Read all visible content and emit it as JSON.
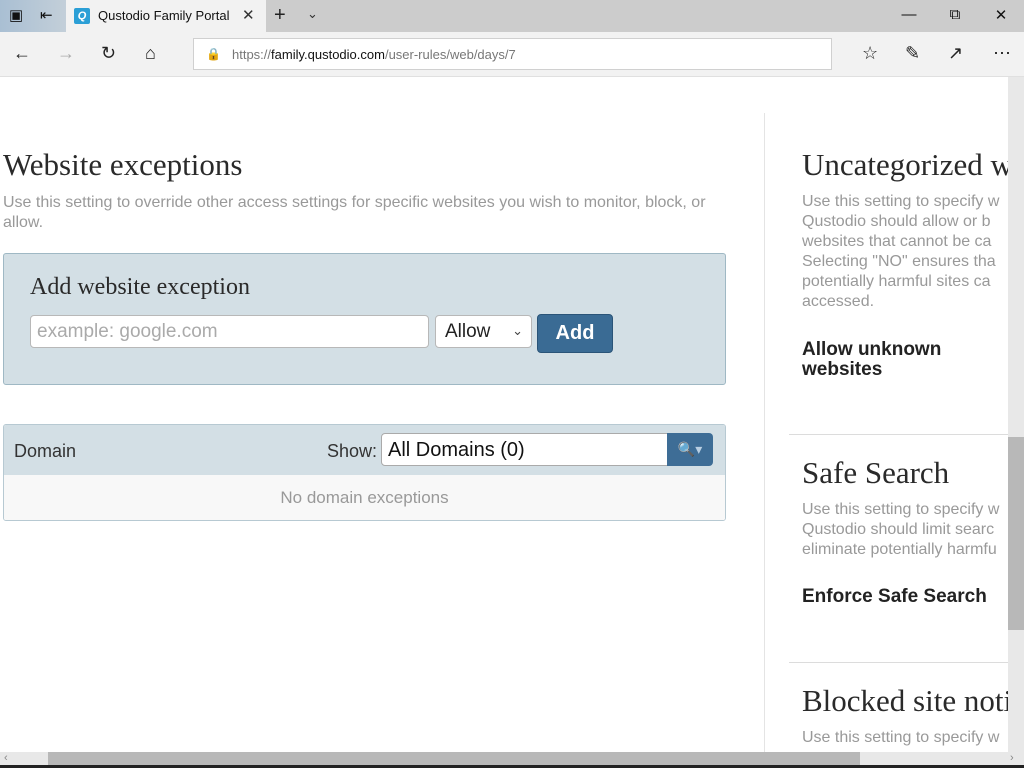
{
  "browser": {
    "tab_title": "Qustodio Family Portal",
    "tab_favicon": "Q",
    "url_scheme": "https://",
    "url_host": "family.qustodio.com",
    "url_path": "/user-rules/web/days/7",
    "icons": [
      "tab-actions-icon",
      "set-aside-tabs-icon",
      "close-icon",
      "new-tab-icon",
      "tab-list-chevron-icon",
      "minimize-icon",
      "maximize-icon",
      "close-window-icon",
      "back-icon",
      "forward-icon",
      "refresh-icon",
      "home-icon",
      "lock-icon",
      "favorites-icon",
      "pen-icon",
      "share-icon",
      "more-icon"
    ]
  },
  "main": {
    "title": "Website exceptions",
    "description": "Use this setting to override other access settings for specific websites you wish to monitor, block, or allow.",
    "add_box": {
      "title": "Add website exception",
      "input_placeholder": "example: google.com",
      "input_value": "",
      "select_value": "Allow",
      "add_label": "Add"
    },
    "table": {
      "column_domain": "Domain",
      "show_label": "Show:",
      "filter_value": "All Domains (0)",
      "empty_text": "No domain exceptions"
    }
  },
  "right": {
    "sections": [
      {
        "title": "Uncategorized w",
        "desc_lines": [
          "Use this setting to specify w",
          "Qustodio should allow or b",
          "websites that cannot be ca",
          "Selecting \"NO\" ensures tha",
          "potentially harmful sites ca",
          "accessed."
        ],
        "option_lines": [
          "Allow unknown",
          "websites"
        ]
      },
      {
        "title": "Safe Search",
        "desc_lines": [
          "Use this setting to specify w",
          "Qustodio should limit searc",
          "eliminate potentially harmfu"
        ],
        "option_lines": [
          "Enforce Safe Search"
        ]
      },
      {
        "title": "Blocked site noti",
        "desc_lines": [
          "Use this setting to specify w"
        ]
      }
    ]
  },
  "colors": {
    "accent": "#3a6b94",
    "panel": "#d3dfe5",
    "muted_text": "#999999"
  }
}
